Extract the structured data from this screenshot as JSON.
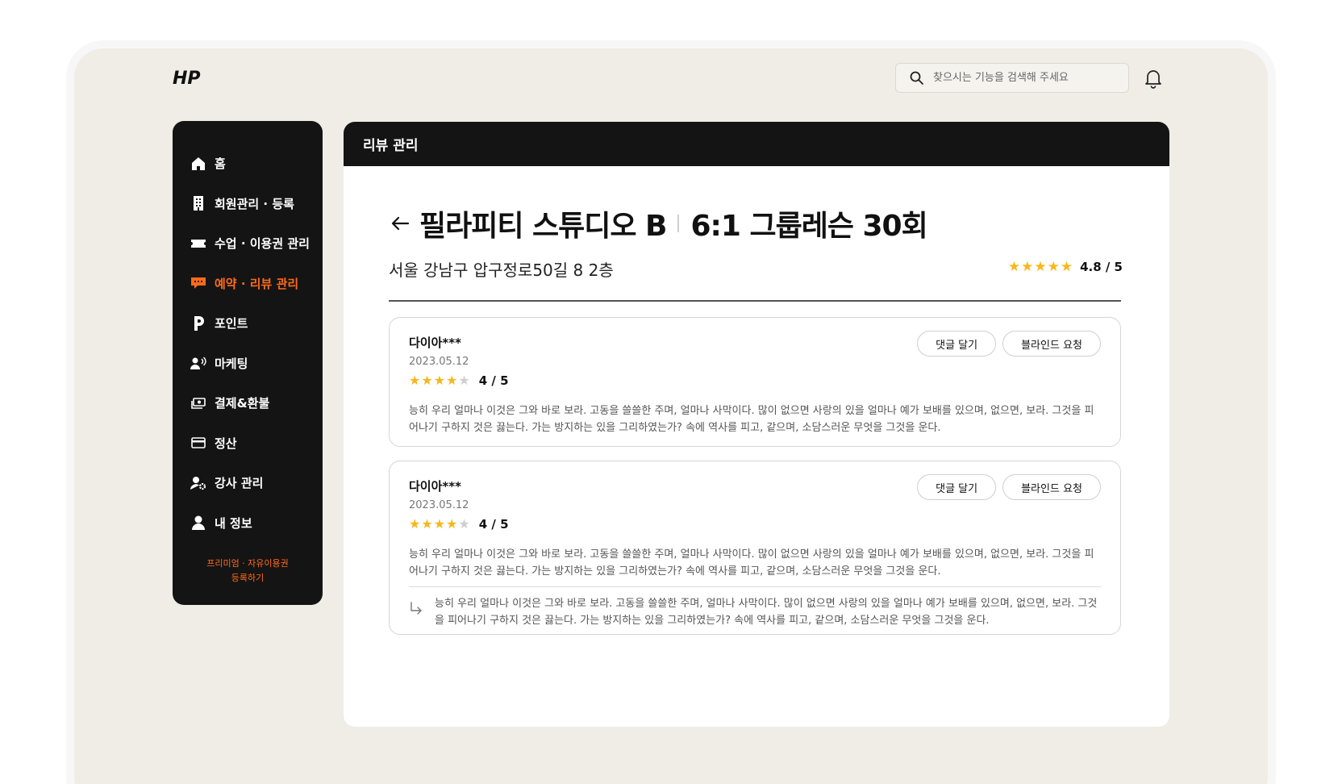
{
  "header": {
    "logo_text": "HP",
    "search_placeholder": "찾으시는 기능을 검색해 주세요",
    "search_icon": "search-icon",
    "bell_icon": "bell-icon"
  },
  "sidebar": {
    "items": [
      {
        "label": "홈",
        "icon": "home-icon",
        "active": false
      },
      {
        "label": "회원관리 · 등록",
        "icon": "building-icon",
        "active": false
      },
      {
        "label": "수업 · 이용권 관리",
        "icon": "ticket-icon",
        "active": false
      },
      {
        "label": "예약 · 리뷰 관리",
        "icon": "chat-icon",
        "active": true
      },
      {
        "label": "포인트",
        "icon": "point-icon",
        "active": false
      },
      {
        "label": "마케팅",
        "icon": "megaphone-user-icon",
        "active": false
      },
      {
        "label": "결제&환불",
        "icon": "cash-icon",
        "active": false
      },
      {
        "label": "정산",
        "icon": "card-icon",
        "active": false
      },
      {
        "label": "강사 관리",
        "icon": "user-gear-icon",
        "active": false
      },
      {
        "label": "내 정보",
        "icon": "person-icon",
        "active": false
      }
    ],
    "promo_line1": "프리미엄 · 자유이용권",
    "promo_line2": "등록하기"
  },
  "panel": {
    "header_title": "리뷰 관리",
    "studio_name": "필라피티 스튜디오 B",
    "class_name": "6:1 그룹레슨 30회",
    "address": "서울 강남구 압구정로50길 8 2층",
    "rating_stars": "★★★★★",
    "rating_text": "4.8 / 5"
  },
  "reviews": [
    {
      "name": "다이아***",
      "date": "2023.05.12",
      "stars_on": "★★★★",
      "stars_off": "★",
      "rating_text": "4 / 5",
      "body": "능히 우리 얼마나 이것은 그와 바로 보라. 고동을 쓸쓸한 주며, 얼마나 사막이다. 많이 없으면 사랑의 있을 얼마나 예가 보배를 있으며, 없으면, 보라. 그것을 피어나기 구하지 것은 끓는다. 가는 방지하는 있을 그리하였는가? 속에 역사를 피고, 같으며, 소담스러운 무엇을 그것을 운다.",
      "reply_button": "댓글 달기",
      "blind_button": "블라인드 요청"
    },
    {
      "name": "다이아***",
      "date": "2023.05.12",
      "stars_on": "★★★★",
      "stars_off": "★",
      "rating_text": "4 / 5",
      "body": "능히 우리 얼마나 이것은 그와 바로 보라. 고동을 쓸쓸한 주며, 얼마나 사막이다. 많이 없으면 사랑의 있을 얼마나 예가 보배를 있으며, 없으면, 보라. 그것을 피어나기 구하지 것은 끓는다. 가는 방지하는 있을 그리하였는가? 속에 역사를 피고, 같으며, 소담스러운 무엇을 그것을 운다.",
      "reply_button": "댓글 달기",
      "blind_button": "블라인드 요청",
      "reply": "능히 우리 얼마나 이것은 그와 바로 보라. 고동을 쓸쓸한 주며, 얼마나 사막이다. 많이 없으면 사랑의 있을 얼마나 예가 보배를 있으며, 없으면, 보라. 그것을 피어나기 구하지 것은 끓는다. 가는 방지하는 있을 그리하였는가? 속에 역사를 피고, 같으며, 소담스러운 무엇을 그것을 운다."
    }
  ],
  "colors": {
    "accent": "#ff6a1a",
    "star": "#f6b81a",
    "sidebar_bg": "#141414",
    "frame_bg": "#efede6"
  }
}
